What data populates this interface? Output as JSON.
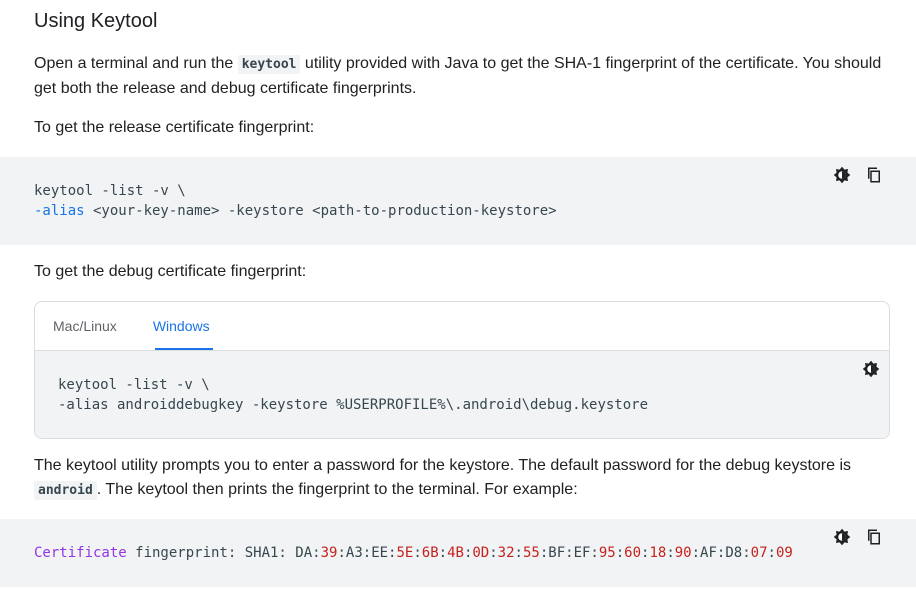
{
  "heading": "Using Keytool",
  "intro": {
    "before": "Open a terminal and run the ",
    "code": "keytool",
    "after": " utility provided with Java to get the SHA-1 fingerprint of the certificate. You should get both the release and debug certificate fingerprints."
  },
  "release_label": "To get the release certificate fingerprint:",
  "release_code": {
    "line1": "keytool -list -v \\",
    "line2_kw": "-alias",
    "line2_rest": " <your-key-name> -keystore <path-to-production-keystore>"
  },
  "debug_label": "To get the debug certificate fingerprint:",
  "tabs": [
    {
      "label": "Mac/Linux"
    },
    {
      "label": "Windows"
    }
  ],
  "debug_code": {
    "line1": "keytool -list -v \\",
    "line2": "-alias androiddebugkey -keystore %USERPROFILE%\\.android\\debug.keystore"
  },
  "outro": {
    "before": "The keytool utility prompts you to enter a password for the keystore. The default password for the debug keystore is ",
    "code": "android",
    "after": ". The keytool then prints the fingerprint to the terminal. For example:"
  },
  "example": {
    "label": "Certificate",
    "rest": " fingerprint: SHA1: ",
    "parts": [
      {
        "t": "DA",
        "n": false
      },
      {
        "t": ":",
        "n": false
      },
      {
        "t": "39",
        "n": true
      },
      {
        "t": ":",
        "n": false
      },
      {
        "t": "A3",
        "n": false
      },
      {
        "t": ":",
        "n": false
      },
      {
        "t": "EE",
        "n": false
      },
      {
        "t": ":",
        "n": false
      },
      {
        "t": "5E",
        "n": true
      },
      {
        "t": ":",
        "n": false
      },
      {
        "t": "6B",
        "n": true
      },
      {
        "t": ":",
        "n": false
      },
      {
        "t": "4B",
        "n": true
      },
      {
        "t": ":",
        "n": false
      },
      {
        "t": "0D",
        "n": true
      },
      {
        "t": ":",
        "n": false
      },
      {
        "t": "32",
        "n": true
      },
      {
        "t": ":",
        "n": false
      },
      {
        "t": "55",
        "n": true
      },
      {
        "t": ":",
        "n": false
      },
      {
        "t": "BF",
        "n": false
      },
      {
        "t": ":",
        "n": false
      },
      {
        "t": "EF",
        "n": false
      },
      {
        "t": ":",
        "n": false
      },
      {
        "t": "95",
        "n": true
      },
      {
        "t": ":",
        "n": false
      },
      {
        "t": "60",
        "n": true
      },
      {
        "t": ":",
        "n": false
      },
      {
        "t": "18",
        "n": true
      },
      {
        "t": ":",
        "n": false
      },
      {
        "t": "90",
        "n": true
      },
      {
        "t": ":",
        "n": false
      },
      {
        "t": "AF",
        "n": false
      },
      {
        "t": ":",
        "n": false
      },
      {
        "t": "D8",
        "n": false
      },
      {
        "t": ":",
        "n": false
      },
      {
        "t": "07",
        "n": true
      },
      {
        "t": ":",
        "n": false
      },
      {
        "t": "09",
        "n": true
      }
    ]
  },
  "icons": {
    "theme": "dark-theme-icon",
    "copy": "copy-icon"
  },
  "colors": {
    "accent": "#1a73e8",
    "code_bg": "#f1f3f4",
    "keyword": "#1a73e8",
    "type": "#9334e6",
    "number": "#c5221f"
  }
}
